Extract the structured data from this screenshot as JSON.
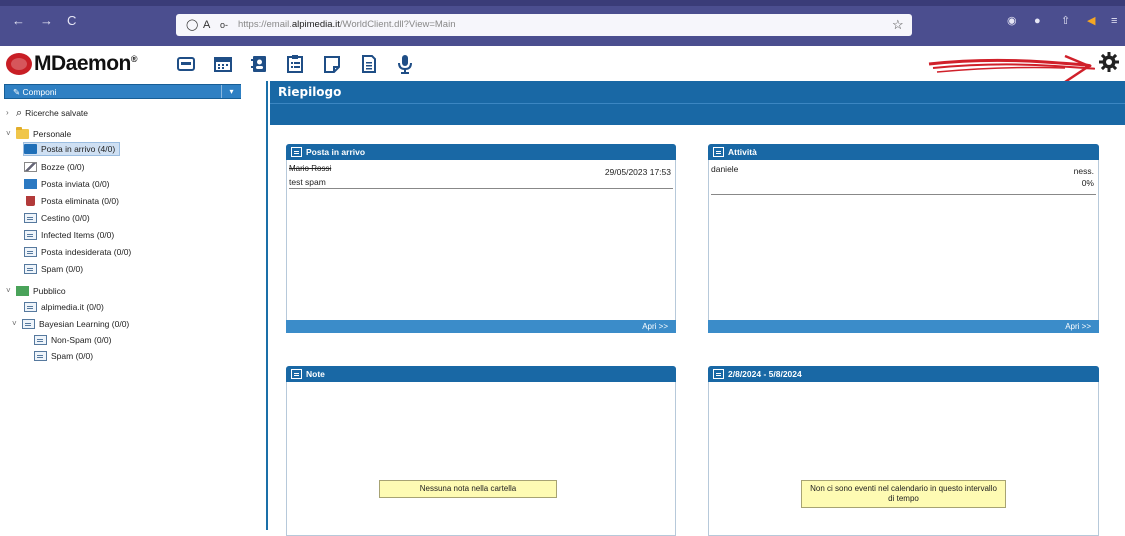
{
  "browser": {
    "back_icon": "←",
    "forward_icon": "→",
    "reload_icon": "C",
    "url_prefix": "https://email.",
    "url_domain": "alpimedia.it",
    "url_path": "/WorldClient.dll?View=Main",
    "shield_icon": "◯",
    "lock_icon": "A",
    "key_icon": "o-",
    "star_icon": "☆"
  },
  "app": {
    "logo_name": "MDaemon",
    "logo_reg": "®",
    "toolbar_icons": [
      "mail-icon",
      "calendar-icon",
      "contacts-icon",
      "tasks-icon",
      "notes-icon",
      "documents-icon",
      "microphone-icon"
    ],
    "settings_icon": "gear-icon"
  },
  "sidebar": {
    "compose_label": "Componi",
    "compose_drop": "▾",
    "saved_searches": "Ricerche salvate",
    "personal": "Personale",
    "folders": [
      {
        "label": "Posta in arrivo (4/0)"
      },
      {
        "label": "Bozze (0/0)"
      },
      {
        "label": "Posta inviata (0/0)"
      },
      {
        "label": "Posta eliminata (0/0)"
      },
      {
        "label": "Cestino (0/0)"
      },
      {
        "label": "Infected Items (0/0)"
      },
      {
        "label": "Posta indesiderata (0/0)"
      },
      {
        "label": "Spam (0/0)"
      }
    ],
    "public": "Pubblico",
    "public_folders": [
      {
        "label": "alpimedia.it (0/0)"
      },
      {
        "label": "Bayesian Learning (0/0)"
      },
      {
        "label": "Non-Spam (0/0)"
      },
      {
        "label": "Spam (0/0)"
      }
    ]
  },
  "main": {
    "title": "Riepilogo",
    "inbox": {
      "title": "Posta in arrivo",
      "from": "Mario Rossi",
      "date": "29/05/2023 17:53",
      "subject": "test spam",
      "open": "Apri >>"
    },
    "tasks": {
      "title": "Attività",
      "name": "daniele",
      "due": "ness.",
      "percent": "0%",
      "open": "Apri >>"
    },
    "notes": {
      "title": "Note",
      "empty": "Nessuna nota nella cartella"
    },
    "calendar": {
      "title": "2/8/2024 - 5/8/2024",
      "empty": "Non ci sono eventi nel calendario in questo intervallo di tempo"
    }
  },
  "colors": {
    "accent": "#1968a5",
    "browser": "#4b4e8f",
    "notice": "#fefbb3"
  }
}
